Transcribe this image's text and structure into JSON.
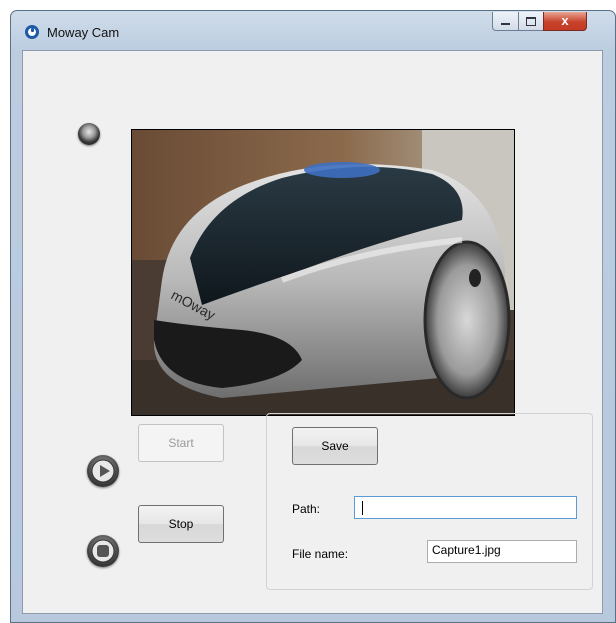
{
  "window": {
    "title": "Moway Cam",
    "controls": {
      "minimize": "minimize",
      "maximize": "maximize",
      "close": "x"
    }
  },
  "capture": {
    "start_label": "Start",
    "stop_label": "Stop",
    "start_enabled": false
  },
  "save_panel": {
    "save_label": "Save",
    "path_label": "Path:",
    "path_value": "",
    "filename_label": "File name:",
    "filename_value": "Capture1.jpg"
  },
  "icons": {
    "app": "moway-cam-icon",
    "status": "status-led-icon",
    "play": "play-icon",
    "stop": "stop-icon"
  },
  "colors": {
    "accent": "#1e5aa8",
    "close_button": "#c8432c",
    "client_background": "#f0f0f0"
  }
}
